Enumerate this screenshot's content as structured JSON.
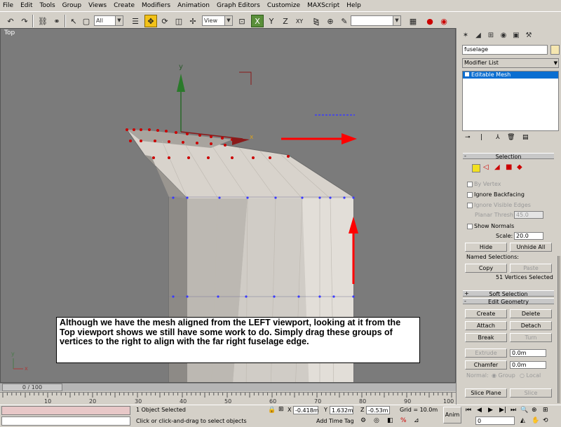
{
  "menu": [
    "File",
    "Edit",
    "Tools",
    "Group",
    "Views",
    "Create",
    "Modifiers",
    "Animation",
    "Graph Editors",
    "Customize",
    "MAXScript",
    "Help"
  ],
  "toolbar": {
    "selection_filter": "All",
    "ref_coord": "View",
    "named_selection": ""
  },
  "viewport": {
    "label": "Top",
    "annotation": "Although we have the mesh aligned from the LEFT viewport, looking at it from the Top viewport shows we still have some work to do.  Simply drag these groups of vertices to the right to align with the far right fuselage edge.",
    "axis_y": "y",
    "axis_x": "x"
  },
  "timeline": {
    "slider": "0 / 100",
    "ticks": [
      "10",
      "20",
      "30",
      "40",
      "50",
      "60",
      "70",
      "80",
      "90",
      "100"
    ]
  },
  "status": {
    "selected": "1 Object Selected",
    "prompt": "Click or click-and-drag to select objects",
    "x_label": "X",
    "x": "-0.418m",
    "y_label": "Y",
    "y": "1.632m",
    "z_label": "Z",
    "z": "-0.53m",
    "grid": "Grid = 10.0m",
    "add_time_tag": "Add Time Tag",
    "anim": "Anim",
    "frame": "0"
  },
  "panel": {
    "object_name": "fuselage",
    "modifier_list": "Modifier List",
    "stack_item": "Editable Mesh",
    "selection": {
      "title": "Selection",
      "by_vertex": "By Vertex",
      "ignore_backfacing": "Ignore Backfacing",
      "ignore_visible_edges": "Ignore Visible Edges",
      "planar_thresh_label": "Planar Thresh:",
      "planar_thresh": "45.0",
      "show_normals": "Show Normals",
      "scale_label": "Scale:",
      "scale": "20.0",
      "hide": "Hide",
      "unhide_all": "Unhide All",
      "named_selections": "Named Selections:",
      "copy": "Copy",
      "paste": "Paste",
      "count": "51 Vertices Selected"
    },
    "soft_selection": "Soft Selection",
    "edit_geometry": {
      "title": "Edit Geometry",
      "create": "Create",
      "delete": "Delete",
      "attach": "Attach",
      "detach": "Detach",
      "break": "Break",
      "turn": "Turn",
      "extrude": "Extrude",
      "extrude_val": "0.0m",
      "chamfer": "Chamfer",
      "chamfer_val": "0.0m",
      "normal": "Normal:",
      "group": "Group",
      "local": "Local",
      "slice_plane": "Slice Plane",
      "slice": "Slice"
    }
  },
  "colors": {
    "viewport_bg": "#7b7b7b",
    "mesh": "#d8d3cc",
    "selected_vertex": "#cc0000",
    "arrow": "#ff0000",
    "stack_highlight": "#0a6ed1"
  }
}
